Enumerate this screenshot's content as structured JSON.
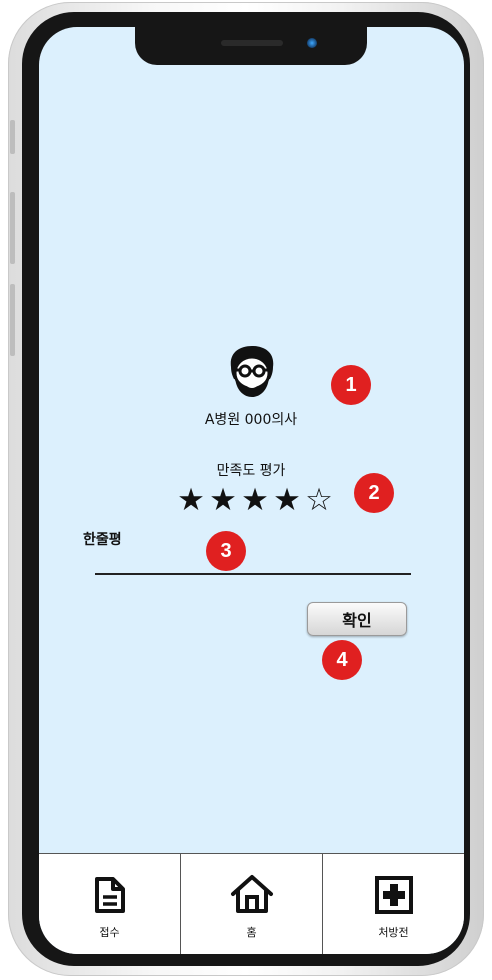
{
  "doctor": {
    "icon": "doctor-avatar-icon",
    "name": "A병원 000의사"
  },
  "rating": {
    "label": "만족도 평가",
    "value": 4,
    "max": 5
  },
  "review": {
    "label": "한줄평",
    "value": ""
  },
  "confirm_label": "확인",
  "markers": [
    "1",
    "2",
    "3",
    "4"
  ],
  "bottom_nav": [
    {
      "label": "접수",
      "icon": "document-icon"
    },
    {
      "label": "홈",
      "icon": "home-icon"
    },
    {
      "label": "처방전",
      "icon": "medical-cross-icon"
    }
  ],
  "colors": {
    "screen_bg": "#dcf0fd",
    "marker": "#e02020"
  }
}
